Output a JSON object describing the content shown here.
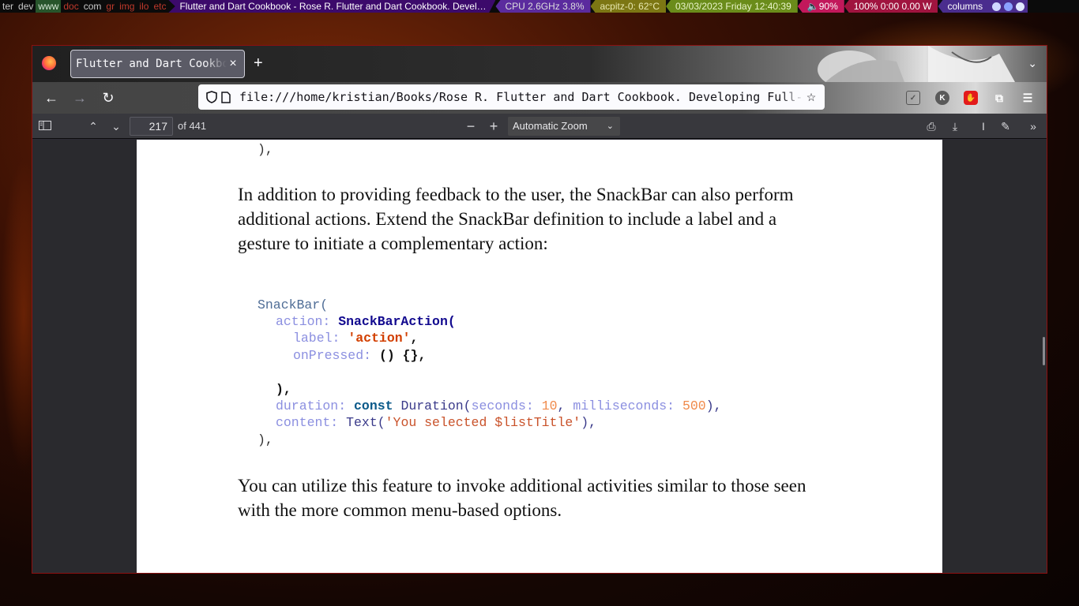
{
  "topbar": {
    "workspaces": [
      {
        "label": "ter",
        "state": "occupied"
      },
      {
        "label": "dev",
        "state": "occupied"
      },
      {
        "label": "www",
        "state": "active"
      },
      {
        "label": "doc",
        "state": "urgent"
      },
      {
        "label": "com",
        "state": "occupied"
      },
      {
        "label": "gr",
        "state": "urgent"
      },
      {
        "label": "img",
        "state": "urgent"
      },
      {
        "label": "ilo",
        "state": "urgent"
      },
      {
        "label": "etc",
        "state": "urgent"
      }
    ],
    "window_title": "Flutter and Dart Cookbook - Rose R. Flutter and Dart Cookbook. Develop…",
    "cpu": "CPU 2.6GHz 3.8%",
    "temp": "acpitz-0: 62°C",
    "datetime": "03/03/2023 Friday  12:40:39",
    "volume": "🔈90%",
    "battery": "100% 0:00 0.00 W",
    "layout": "columns"
  },
  "browser": {
    "tab_title": "Flutter and Dart Cookbook. Developing Full-Stack Applications",
    "tab_close": "×",
    "new_tab": "+",
    "url": "file:///home/kristian/Books/Rose R. Flutter and Dart Cookbook. Developing Full-Stack Applications.pdf"
  },
  "pdf_toolbar": {
    "page_number": "217",
    "page_count": "of 441",
    "zoom": "Automatic Zoom"
  },
  "document": {
    "top_fragment": "),",
    "paragraph1": "In addition to providing feedback to the user, the SnackBar can also perform additional actions. Extend the SnackBar definition to include a label and a gesture to initiate a complementary action:",
    "code": {
      "l1_ident": "SnackBar(",
      "l2_named": "action:",
      "l2_class": "SnackBarAction(",
      "l3_named": "label:",
      "l3_str": "'action'",
      "l3_tail": ",",
      "l4_named": "onPressed:",
      "l4_tail": "() {},",
      "l5_close": "),",
      "l6_named": "duration:",
      "l6_const": "const",
      "l6_type": "Duration(",
      "l6_arg1": "seconds:",
      "l6_val1": "10",
      "l6_comma": ",",
      "l6_arg2": "milliseconds:",
      "l6_val2": "500",
      "l6_end": "),",
      "l7_named": "content:",
      "l7_type": "Text(",
      "l7_str": "'You selected $listTitle'",
      "l7_end": "),",
      "l8_close": "),"
    },
    "paragraph2": "You can utilize this feature to invoke additional activities similar to those seen with the more common menu-based options."
  }
}
